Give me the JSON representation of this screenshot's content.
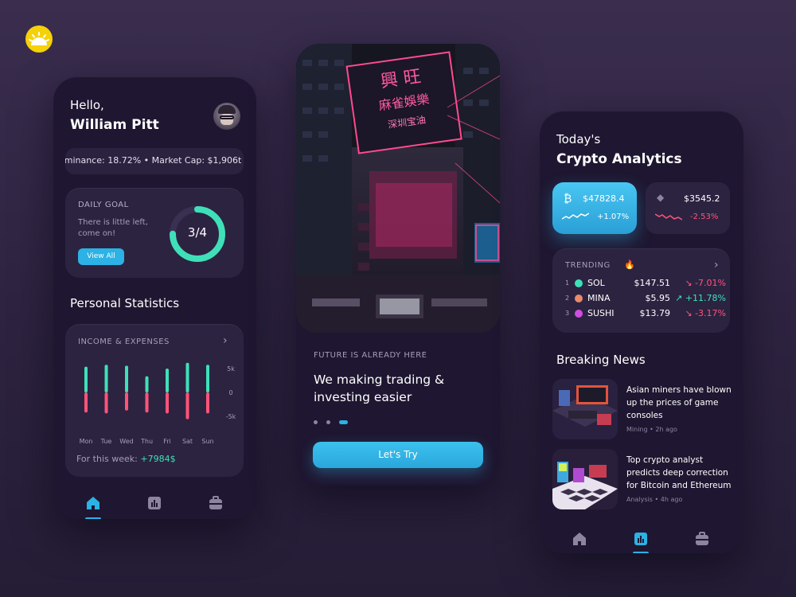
{
  "brand": {
    "logo_icon": "sun-logo-icon",
    "accent": "#2cb2e4"
  },
  "dashboard": {
    "greeting": "Hello,",
    "user_name": "William Pitt",
    "ticker": "ominance: 18.72%  •  Market Cap:  $1,906t",
    "daily_goal": {
      "title": "DAILY GOAL",
      "description": "There is little left, come on!",
      "button_label": "View All",
      "progress_label": "3/4",
      "progress": 0.75
    },
    "section_title": "Personal Statistics",
    "income_card": {
      "title": "INCOME & EXPENSES",
      "week_label": "For this week:",
      "week_value": "+7984$"
    },
    "nav": [
      "home-icon",
      "stats-icon",
      "wallet-icon"
    ]
  },
  "chart_data": {
    "type": "bar",
    "title": "INCOME & EXPENSES",
    "categories": [
      "Mon",
      "Tue",
      "Wed",
      "Thu",
      "Fri",
      "Sat",
      "Sun"
    ],
    "series": [
      {
        "name": "income",
        "values": [
          5.4,
          5.8,
          5.6,
          3.4,
          5.0,
          6.2,
          5.8
        ]
      },
      {
        "name": "expenses",
        "values": [
          -4.2,
          -4.4,
          -3.8,
          -4.2,
          -4.4,
          -5.6,
          -4.4
        ]
      }
    ],
    "y_ticks": [
      "5k",
      "0",
      "-5k"
    ],
    "ylim": [
      -7,
      7
    ],
    "colors": {
      "income": "#3fe0b8",
      "expenses": "#ff5478"
    }
  },
  "onboarding": {
    "hero_image": "neon-city-building-photo",
    "hero_sign_text": "興旺 麻雀娛樂 深圳宝油",
    "tagline": "FUTURE IS ALREADY HERE",
    "heading": "We making trading & investing easier",
    "button_label": "Let's Try",
    "page_dots": 3,
    "active_dot": 2
  },
  "analytics": {
    "title_line1": "Today's",
    "title_line2": "Crypto Analytics",
    "coins": [
      {
        "symbol": "bitcoin-icon",
        "glyph": "₿",
        "price": "$47828.4",
        "change": "+1.07%",
        "trend": "up"
      },
      {
        "symbol": "ethereum-icon",
        "glyph": "◆",
        "price": "$3545.2",
        "change": "-2.53%",
        "trend": "down"
      }
    ],
    "trending": {
      "title": "TRENDING",
      "fire_icon": "fire-icon",
      "rows": [
        {
          "rank": "1",
          "name": "SOL",
          "price": "$147.51",
          "change": "-7.01%",
          "trend": "down",
          "color": "#3fe0b8"
        },
        {
          "rank": "2",
          "name": "MINA",
          "price": "$5.95",
          "change": "+11.78%",
          "trend": "up",
          "color": "#e98a6b"
        },
        {
          "rank": "3",
          "name": "SUSHI",
          "price": "$13.79",
          "change": "-3.17%",
          "trend": "down",
          "color": "#d04ee0"
        }
      ]
    },
    "news_title": "Breaking News",
    "news": [
      {
        "headline": "Asian miners have blown up the prices of game consoles",
        "meta": "Mining • 2h ago",
        "thumb": "gaming-room-thumbnail"
      },
      {
        "headline": "Top crypto analyst predicts deep correction for Bitcoin and Ethereum",
        "meta": "Analysis • 4h ago",
        "thumb": "arcade-room-thumbnail"
      }
    ]
  }
}
